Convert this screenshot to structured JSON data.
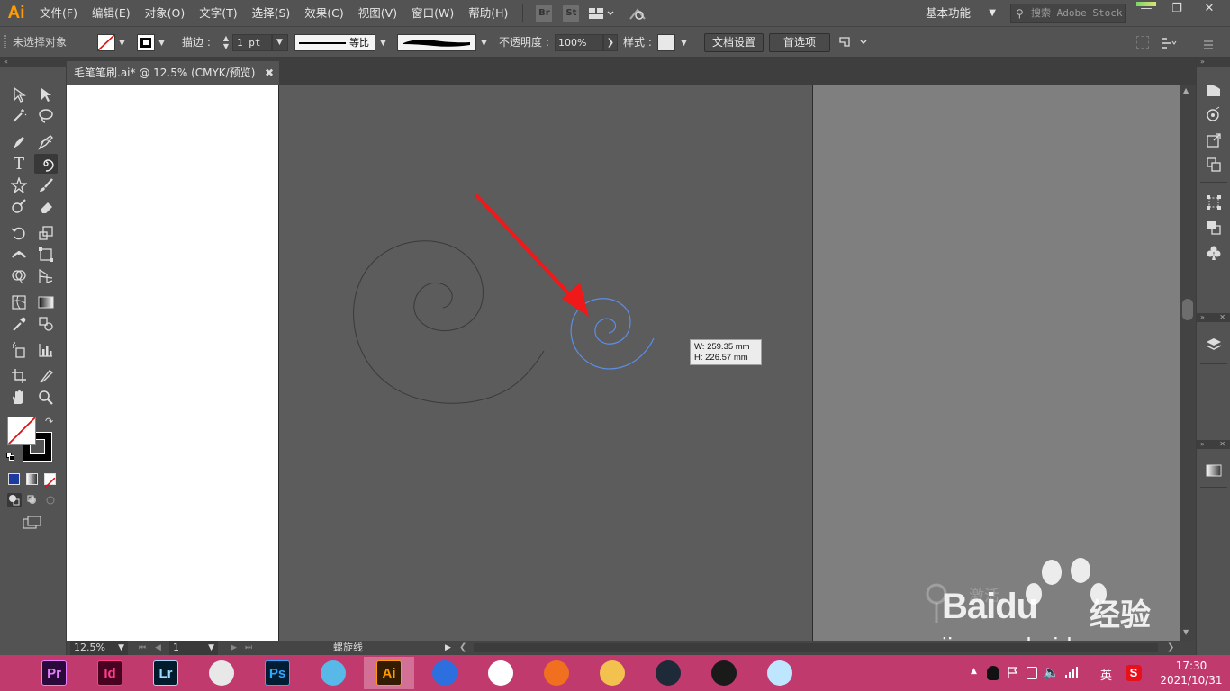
{
  "app": {
    "logo": "Ai",
    "menu": [
      "文件(F)",
      "编辑(E)",
      "对象(O)",
      "文字(T)",
      "选择(S)",
      "效果(C)",
      "视图(V)",
      "窗口(W)",
      "帮助(H)"
    ],
    "bridge_label": "Br",
    "stock_label": "St",
    "workspace": "基本功能",
    "search_placeholder": "搜索 Adobe Stock"
  },
  "controlbar": {
    "selection_status": "未选择对象",
    "stroke_label": "描边",
    "stroke_weight": "1 pt",
    "stroke_profile": "等比",
    "opacity_label": "不透明度",
    "opacity_value": "100%",
    "style_label": "样式",
    "doc_setup_button": "文档设置",
    "preferences_button": "首选项"
  },
  "document": {
    "tab_title": "毛笔笔刷.ai* @ 12.5% (CMYK/预览)",
    "tooltip_w": "W: 259.35 mm",
    "tooltip_h": "H: 226.57 mm"
  },
  "statusbar": {
    "zoom": "12.5%",
    "artboard_number": "1",
    "current_tool": "螺旋线"
  },
  "watermark": {
    "activate_text": "激活",
    "brand_baidu": "Baidu",
    "brand_jingyan": "经验",
    "url": "jingyan.baidu.com"
  },
  "taskbar": {
    "apps": [
      {
        "name": "premiere",
        "label": "Pr",
        "bg": "#2a0a3b",
        "fg": "#e77cff"
      },
      {
        "name": "indesign",
        "label": "Id",
        "bg": "#49021f",
        "fg": "#ff3d8b"
      },
      {
        "name": "lightroom",
        "label": "Lr",
        "bg": "#001c2c",
        "fg": "#9fd8ff"
      },
      {
        "name": "umbrella-app",
        "label": "",
        "bg": "#e8e8e8",
        "fg": "#c00"
      },
      {
        "name": "photoshop",
        "label": "Ps",
        "bg": "#001d34",
        "fg": "#31a8ff"
      },
      {
        "name": "cat-app",
        "label": "",
        "bg": "#58b8e8",
        "fg": "#fff"
      },
      {
        "name": "illustrator",
        "label": "Ai",
        "bg": "#331c00",
        "fg": "#ff9a00"
      },
      {
        "name": "browser-q",
        "label": "",
        "bg": "#2e6fe0",
        "fg": "#fff"
      },
      {
        "name": "chrome",
        "label": "",
        "bg": "#ffffff",
        "fg": "#4285f4"
      },
      {
        "name": "orange-app",
        "label": "",
        "bg": "#f07020",
        "fg": "#fff"
      },
      {
        "name": "file-explorer",
        "label": "",
        "bg": "#f2c14e",
        "fg": "#fff"
      },
      {
        "name": "video-app",
        "label": "",
        "bg": "#1f2a38",
        "fg": "#fff"
      },
      {
        "name": "qq",
        "label": "",
        "bg": "#1a1a1a",
        "fg": "#fff"
      },
      {
        "name": "notes-app",
        "label": "",
        "bg": "#bfe6ff",
        "fg": "#225"
      }
    ],
    "ime_lang": "英",
    "time": "17:30",
    "date": "2021/10/31"
  }
}
